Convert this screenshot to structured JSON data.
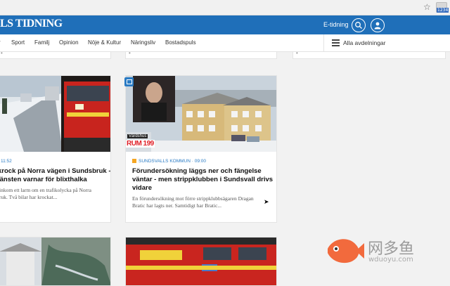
{
  "browser": {
    "star_icon": "star-icon",
    "extension_badge": "1234"
  },
  "header": {
    "logo": "LS TIDNING",
    "etidning": "E-tidning",
    "brand_color": "#1f6fb9"
  },
  "nav": {
    "items": [
      "r",
      "Sport",
      "Familj",
      "Opinion",
      "Nöje & Kultur",
      "Näringsliv",
      "Bostadspuls"
    ],
    "all_sections": "Alla avdelningar"
  },
  "articles": [
    {
      "meta": "11:52",
      "title_l1": "krock på Norra vägen i Sundsbruk -",
      "title_l2": "jänsten varnar för blixthalka",
      "lead_l1": "inkom ett larm om en trafikolycka på Norra",
      "lead_l2": "ruk. Två bilar har krockat..."
    },
    {
      "meta": "SUNDSVALLS KOMMUN · 09:00",
      "title_l1": "Förundersökning läggs ner och fängelse",
      "title_l2": "väntar - men strippklubben i Sundsvall drivs",
      "title_l3": "vidare",
      "lead_l1": "En förundersökning mot förre strippklubbsägaren Dragan",
      "lead_l2": "Bratic har lagts ner. Samtidigt har Bratic..."
    }
  ],
  "image_labels": {
    "vardshus": "Värdshus",
    "rum": "RUM 199"
  },
  "watermark": {
    "text": "网多鱼",
    "url": "wduoyu.com"
  }
}
